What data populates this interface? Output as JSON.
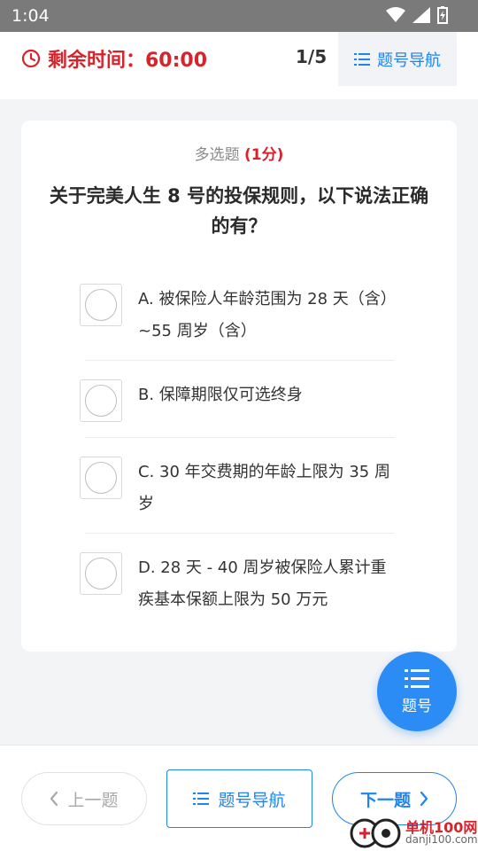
{
  "status_bar": {
    "time": "1:04"
  },
  "header": {
    "timer_label": "剩余时间：60:00",
    "progress": "1/5",
    "nav_label": "题号导航"
  },
  "question": {
    "type": "多选题",
    "score": "(1分)",
    "title": "关于完美人生 8 号的投保规则，以下说法正确的有？",
    "options": [
      {
        "text": "A. 被保险人年龄范围为 28 天（含）~55 周岁（含）"
      },
      {
        "text": "B. 保障期限仅可选终身"
      },
      {
        "text": "C. 30 年交费期的年龄上限为 35 周岁"
      },
      {
        "text": "D. 28 天 - 40 周岁被保险人累计重疾基本保额上限为 50 万元"
      }
    ]
  },
  "fab": {
    "label": "题号"
  },
  "footer": {
    "prev_label": "上一题",
    "nav_label": "题号导航",
    "next_label": "下一题"
  },
  "watermark": {
    "name": "单机100网",
    "url": "danji100.com"
  },
  "colors": {
    "accent": "#1e84f0",
    "timer": "#d8232a",
    "fab": "#2b8cf5"
  }
}
